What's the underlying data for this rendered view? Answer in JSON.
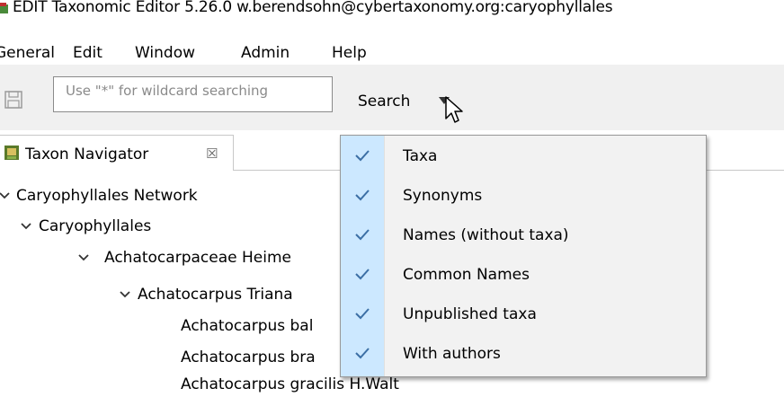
{
  "window": {
    "title": "EDIT Taxonomic Editor 5.26.0 w.berendsohn@cybertaxonomy.org:caryophyllales"
  },
  "menubar": {
    "items": [
      "General",
      "Edit",
      "Window",
      "Admin",
      "Help"
    ]
  },
  "toolbar": {
    "search_placeholder": "Use \"*\" for wildcard searching",
    "search_value": "",
    "search_label": "Search"
  },
  "view": {
    "tab_label": "Taxon Navigator",
    "tab_close": "☒"
  },
  "tree": {
    "rows": [
      {
        "label": "Caryophyllales Network",
        "expanded": true
      },
      {
        "label": "Caryophyllales",
        "expanded": true
      },
      {
        "label": "Achatocarpaceae Heime",
        "expanded": true
      },
      {
        "label": "Achatocarpus Triana",
        "expanded": true
      },
      {
        "label": "Achatocarpus bal",
        "expanded": false
      },
      {
        "label": "Achatocarpus bra",
        "expanded": false
      },
      {
        "label": "Achatocarpus gracilis H.Walt",
        "expanded": false
      }
    ]
  },
  "search_menu": {
    "items": [
      {
        "label": "Taxa",
        "checked": true
      },
      {
        "label": "Synonyms",
        "checked": true
      },
      {
        "label": "Names (without taxa)",
        "checked": true
      },
      {
        "label": "Common Names",
        "checked": true
      },
      {
        "label": "Unpublished taxa",
        "checked": true
      },
      {
        "label": "With authors",
        "checked": true
      }
    ]
  },
  "colors": {
    "check_column": "#cce8ff",
    "check_mark": "#3c6fa5",
    "menu_background": "#f2f2f2",
    "toolbar_background": "#f0f0f0"
  }
}
